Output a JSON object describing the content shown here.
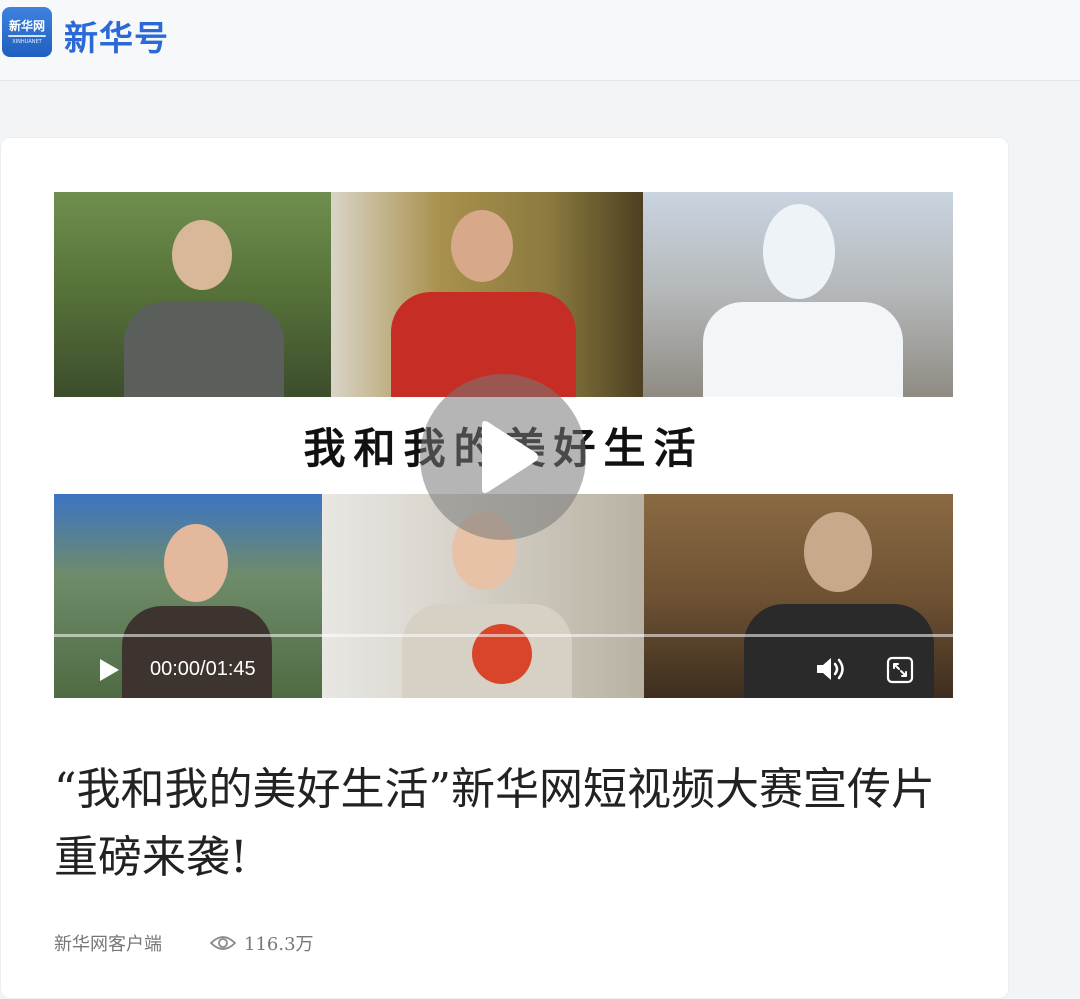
{
  "header": {
    "logo_text": "新华网",
    "logo_sub": "XINHUANET",
    "brand_name": "新华号"
  },
  "video": {
    "overlay_title": "我和我的美好生活",
    "current_time": "00:00",
    "duration": "01:45",
    "time_display": "00:00/01:45",
    "progress": 0,
    "icons": [
      "play-icon",
      "volume-icon",
      "fullscreen-icon"
    ]
  },
  "article": {
    "title": "“我和我的美好生活”新华网短视频大赛宣传片重磅来袭!",
    "source": "新华网客户端",
    "views": "116.3万"
  },
  "colors": {
    "brand_blue": "#2a69d6",
    "page_bg": "#f3f4f6",
    "card_bg": "#ffffff"
  }
}
